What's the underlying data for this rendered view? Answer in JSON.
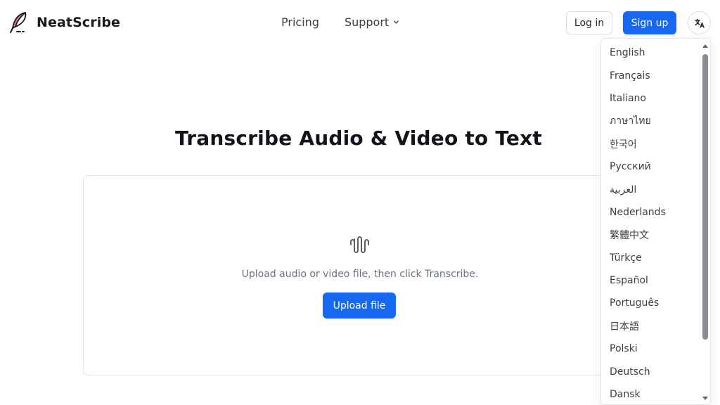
{
  "brand": {
    "name": "NeatScribe",
    "logo_icon": "quill-pen-icon",
    "accent": "#e8467c"
  },
  "nav": {
    "pricing": "Pricing",
    "support": "Support"
  },
  "auth": {
    "login": "Log in",
    "signup": "Sign up"
  },
  "language_button_icon": "translate-icon",
  "main": {
    "title": "Transcribe Audio & Video to Text",
    "upload_icon": "audio-wave-icon",
    "upload_hint": "Upload audio or video file, then click Transcribe.",
    "upload_button": "Upload file"
  },
  "colors": {
    "primary": "#1668f0",
    "text": "#1f2328",
    "muted": "#6b7280"
  },
  "languages": [
    "English",
    "Français",
    "Italiano",
    "ภาษาไทย",
    "한국어",
    "Русский",
    "العربية",
    "Nederlands",
    "繁體中文",
    "Türkçe",
    "Español",
    "Português",
    "日本語",
    "Polski",
    "Deutsch",
    "Dansk"
  ]
}
